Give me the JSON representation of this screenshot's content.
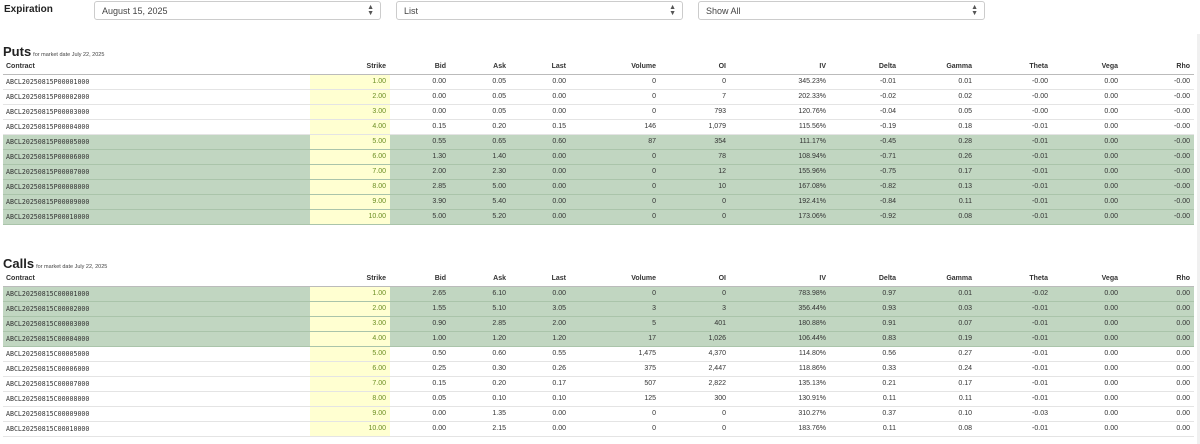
{
  "toolbar": {
    "expiration_label": "Expiration",
    "expiration_value": "August 15, 2025",
    "view_value": "List",
    "filter_value": "Show All"
  },
  "columns": [
    "Contract",
    "Strike",
    "Bid",
    "Ask",
    "Last",
    "Volume",
    "OI",
    "IV",
    "Delta",
    "Gamma",
    "Theta",
    "Vega",
    "Rho"
  ],
  "puts": {
    "title": "Puts",
    "subtitle": "for market date July 22, 2025",
    "rows": [
      {
        "contract": "ABCL20250815P00001000",
        "strike": "1.00",
        "bid": "0.00",
        "ask": "0.05",
        "last": "0.00",
        "volume": "0",
        "oi": "0",
        "iv": "345.23%",
        "delta": "-0.01",
        "gamma": "0.01",
        "theta": "-0.00",
        "vega": "0.00",
        "rho": "-0.00",
        "itm": false
      },
      {
        "contract": "ABCL20250815P00002000",
        "strike": "2.00",
        "bid": "0.00",
        "ask": "0.05",
        "last": "0.00",
        "volume": "0",
        "oi": "7",
        "iv": "202.33%",
        "delta": "-0.02",
        "gamma": "0.02",
        "theta": "-0.00",
        "vega": "0.00",
        "rho": "-0.00",
        "itm": false
      },
      {
        "contract": "ABCL20250815P00003000",
        "strike": "3.00",
        "bid": "0.00",
        "ask": "0.05",
        "last": "0.00",
        "volume": "0",
        "oi": "793",
        "iv": "120.76%",
        "delta": "-0.04",
        "gamma": "0.05",
        "theta": "-0.00",
        "vega": "0.00",
        "rho": "-0.00",
        "itm": false
      },
      {
        "contract": "ABCL20250815P00004000",
        "strike": "4.00",
        "bid": "0.15",
        "ask": "0.20",
        "last": "0.15",
        "volume": "146",
        "oi": "1,079",
        "iv": "115.56%",
        "delta": "-0.19",
        "gamma": "0.18",
        "theta": "-0.01",
        "vega": "0.00",
        "rho": "-0.00",
        "itm": false
      },
      {
        "contract": "ABCL20250815P00005000",
        "strike": "5.00",
        "bid": "0.55",
        "ask": "0.65",
        "last": "0.60",
        "volume": "87",
        "oi": "354",
        "iv": "111.17%",
        "delta": "-0.45",
        "gamma": "0.28",
        "theta": "-0.01",
        "vega": "0.00",
        "rho": "-0.00",
        "itm": true
      },
      {
        "contract": "ABCL20250815P00006000",
        "strike": "6.00",
        "bid": "1.30",
        "ask": "1.40",
        "last": "0.00",
        "volume": "0",
        "oi": "78",
        "iv": "108.94%",
        "delta": "-0.71",
        "gamma": "0.26",
        "theta": "-0.01",
        "vega": "0.00",
        "rho": "-0.00",
        "itm": true
      },
      {
        "contract": "ABCL20250815P00007000",
        "strike": "7.00",
        "bid": "2.00",
        "ask": "2.30",
        "last": "0.00",
        "volume": "0",
        "oi": "12",
        "iv": "155.96%",
        "delta": "-0.75",
        "gamma": "0.17",
        "theta": "-0.01",
        "vega": "0.00",
        "rho": "-0.00",
        "itm": true
      },
      {
        "contract": "ABCL20250815P00008000",
        "strike": "8.00",
        "bid": "2.85",
        "ask": "5.00",
        "last": "0.00",
        "volume": "0",
        "oi": "10",
        "iv": "167.08%",
        "delta": "-0.82",
        "gamma": "0.13",
        "theta": "-0.01",
        "vega": "0.00",
        "rho": "-0.00",
        "itm": true
      },
      {
        "contract": "ABCL20250815P00009000",
        "strike": "9.00",
        "bid": "3.90",
        "ask": "5.40",
        "last": "0.00",
        "volume": "0",
        "oi": "0",
        "iv": "192.41%",
        "delta": "-0.84",
        "gamma": "0.11",
        "theta": "-0.01",
        "vega": "0.00",
        "rho": "-0.00",
        "itm": true
      },
      {
        "contract": "ABCL20250815P00010000",
        "strike": "10.00",
        "bid": "5.00",
        "ask": "5.20",
        "last": "0.00",
        "volume": "0",
        "oi": "0",
        "iv": "173.06%",
        "delta": "-0.92",
        "gamma": "0.08",
        "theta": "-0.01",
        "vega": "0.00",
        "rho": "-0.00",
        "itm": true
      }
    ]
  },
  "calls": {
    "title": "Calls",
    "subtitle": "for market date July 22, 2025",
    "rows": [
      {
        "contract": "ABCL20250815C00001000",
        "strike": "1.00",
        "bid": "2.65",
        "ask": "6.10",
        "last": "0.00",
        "volume": "0",
        "oi": "0",
        "iv": "783.98%",
        "delta": "0.97",
        "gamma": "0.01",
        "theta": "-0.02",
        "vega": "0.00",
        "rho": "0.00",
        "itm": true
      },
      {
        "contract": "ABCL20250815C00002000",
        "strike": "2.00",
        "bid": "1.55",
        "ask": "5.10",
        "last": "3.05",
        "volume": "3",
        "oi": "3",
        "iv": "356.44%",
        "delta": "0.93",
        "gamma": "0.03",
        "theta": "-0.01",
        "vega": "0.00",
        "rho": "0.00",
        "itm": true
      },
      {
        "contract": "ABCL20250815C00003000",
        "strike": "3.00",
        "bid": "0.90",
        "ask": "2.85",
        "last": "2.00",
        "volume": "5",
        "oi": "401",
        "iv": "180.88%",
        "delta": "0.91",
        "gamma": "0.07",
        "theta": "-0.01",
        "vega": "0.00",
        "rho": "0.00",
        "itm": true
      },
      {
        "contract": "ABCL20250815C00004000",
        "strike": "4.00",
        "bid": "1.00",
        "ask": "1.20",
        "last": "1.20",
        "volume": "17",
        "oi": "1,026",
        "iv": "106.44%",
        "delta": "0.83",
        "gamma": "0.19",
        "theta": "-0.01",
        "vega": "0.00",
        "rho": "0.00",
        "itm": true
      },
      {
        "contract": "ABCL20250815C00005000",
        "strike": "5.00",
        "bid": "0.50",
        "ask": "0.60",
        "last": "0.55",
        "volume": "1,475",
        "oi": "4,370",
        "iv": "114.80%",
        "delta": "0.56",
        "gamma": "0.27",
        "theta": "-0.01",
        "vega": "0.00",
        "rho": "0.00",
        "itm": false
      },
      {
        "contract": "ABCL20250815C00006000",
        "strike": "6.00",
        "bid": "0.25",
        "ask": "0.30",
        "last": "0.26",
        "volume": "375",
        "oi": "2,447",
        "iv": "118.86%",
        "delta": "0.33",
        "gamma": "0.24",
        "theta": "-0.01",
        "vega": "0.00",
        "rho": "0.00",
        "itm": false
      },
      {
        "contract": "ABCL20250815C00007000",
        "strike": "7.00",
        "bid": "0.15",
        "ask": "0.20",
        "last": "0.17",
        "volume": "507",
        "oi": "2,822",
        "iv": "135.13%",
        "delta": "0.21",
        "gamma": "0.17",
        "theta": "-0.01",
        "vega": "0.00",
        "rho": "0.00",
        "itm": false
      },
      {
        "contract": "ABCL20250815C00008000",
        "strike": "8.00",
        "bid": "0.05",
        "ask": "0.10",
        "last": "0.10",
        "volume": "125",
        "oi": "300",
        "iv": "130.91%",
        "delta": "0.11",
        "gamma": "0.11",
        "theta": "-0.01",
        "vega": "0.00",
        "rho": "0.00",
        "itm": false
      },
      {
        "contract": "ABCL20250815C00009000",
        "strike": "9.00",
        "bid": "0.00",
        "ask": "1.35",
        "last": "0.00",
        "volume": "0",
        "oi": "0",
        "iv": "310.27%",
        "delta": "0.37",
        "gamma": "0.10",
        "theta": "-0.03",
        "vega": "0.00",
        "rho": "0.00",
        "itm": false
      },
      {
        "contract": "ABCL20250815C00010000",
        "strike": "10.00",
        "bid": "0.00",
        "ask": "2.15",
        "last": "0.00",
        "volume": "0",
        "oi": "0",
        "iv": "183.76%",
        "delta": "0.11",
        "gamma": "0.08",
        "theta": "-0.01",
        "vega": "0.00",
        "rho": "0.00",
        "itm": false
      }
    ]
  }
}
